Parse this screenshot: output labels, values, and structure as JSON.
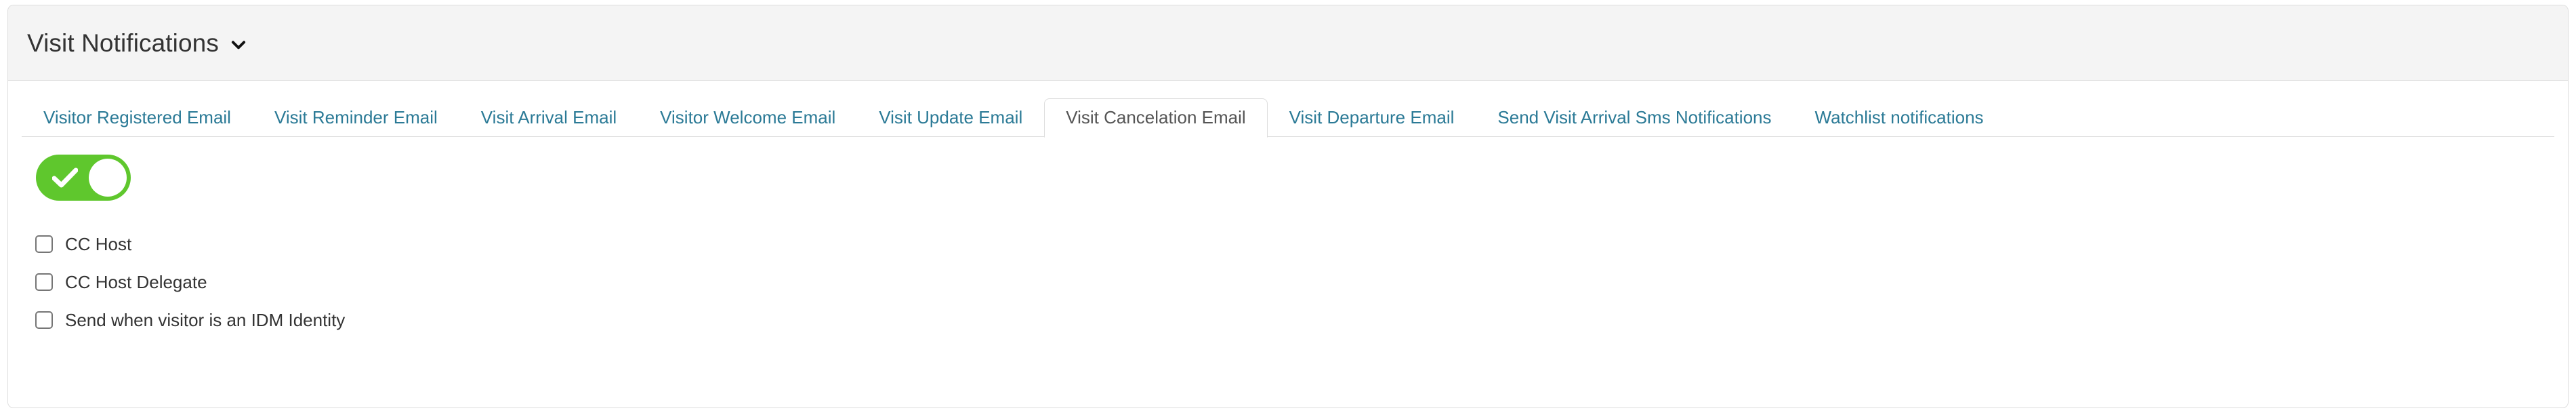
{
  "panel": {
    "title": "Visit Notifications",
    "collapse_icon": "chevron-down-icon"
  },
  "tabs": [
    {
      "label": "Visitor Registered Email",
      "active": false
    },
    {
      "label": "Visit Reminder Email",
      "active": false
    },
    {
      "label": "Visit Arrival Email",
      "active": false
    },
    {
      "label": "Visitor Welcome Email",
      "active": false
    },
    {
      "label": "Visit Update Email",
      "active": false
    },
    {
      "label": "Visit Cancelation Email",
      "active": true
    },
    {
      "label": "Visit Departure Email",
      "active": false
    },
    {
      "label": "Send Visit Arrival Sms Notifications",
      "active": false
    },
    {
      "label": "Watchlist notifications",
      "active": false
    }
  ],
  "content": {
    "enable_toggle": {
      "name": "enable-notification-toggle",
      "state": "on",
      "icon": "check-icon"
    },
    "checkboxes": [
      {
        "label": "CC Host",
        "checked": false
      },
      {
        "label": "CC Host Delegate",
        "checked": false
      },
      {
        "label": "Send when visitor is an IDM Identity",
        "checked": false
      }
    ]
  },
  "colors": {
    "link": "#2b7a96",
    "toggle_on": "#5fc72d",
    "header_bg": "#f4f4f4",
    "border": "#dddddd",
    "text": "#333333",
    "active_tab_text": "#555555"
  }
}
